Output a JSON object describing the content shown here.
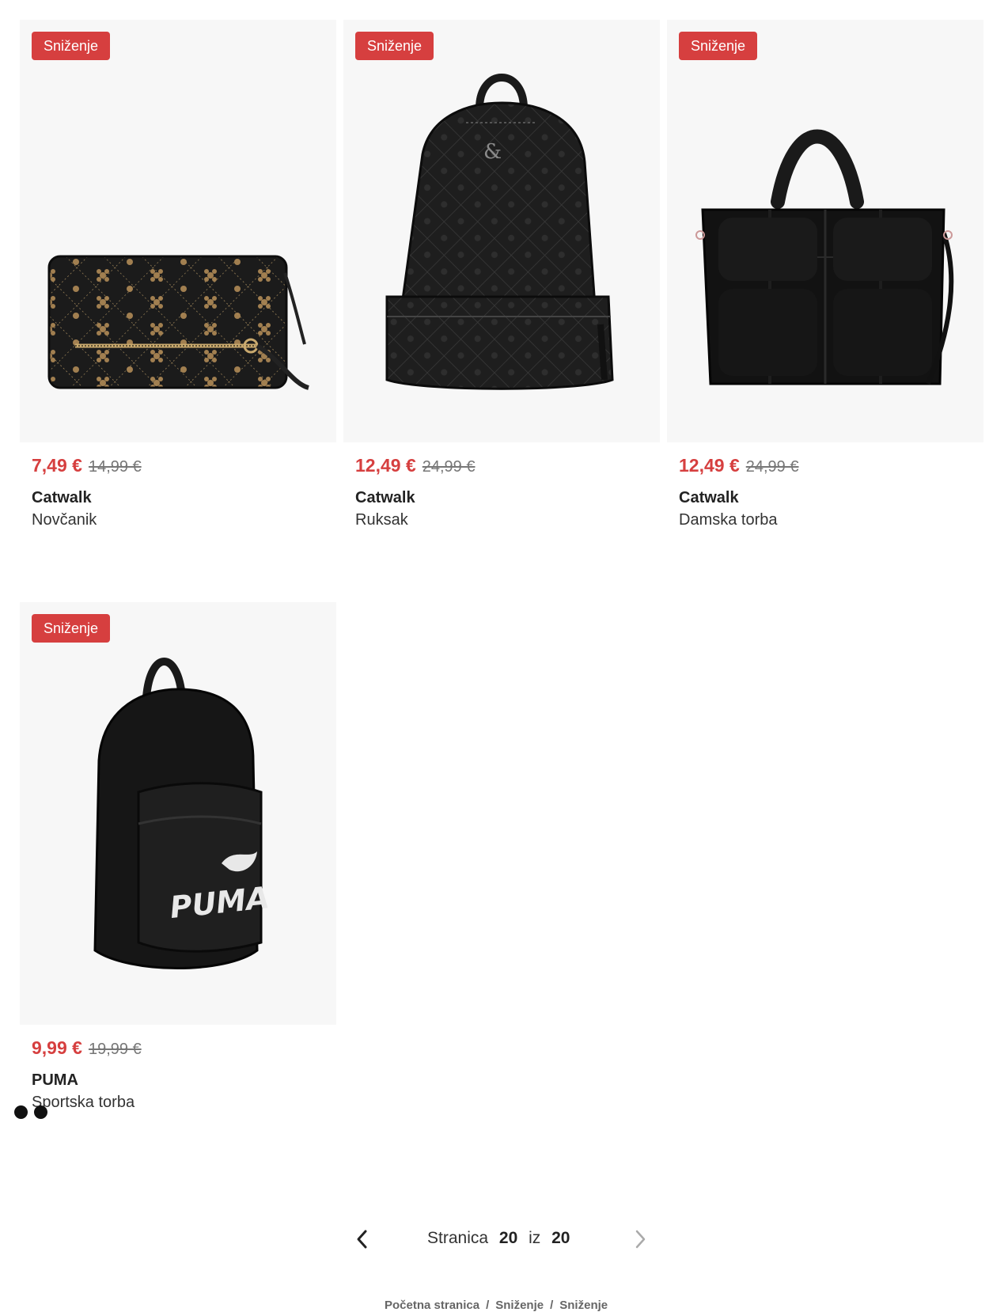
{
  "products": [
    {
      "badge": "Sniženje",
      "price_new": "7,49 €",
      "price_old": "14,99 €",
      "brand": "Catwalk",
      "name": "Novčanik",
      "image": "black-wallet-image"
    },
    {
      "badge": "Sniženje",
      "price_new": "12,49 €",
      "price_old": "24,99 €",
      "brand": "Catwalk",
      "name": "Ruksak",
      "image": "black-backpack-image"
    },
    {
      "badge": "Sniženje",
      "price_new": "12,49 €",
      "price_old": "24,99 €",
      "brand": "Catwalk",
      "name": "Damska torba",
      "image": "black-tote-image"
    },
    {
      "badge": "Sniženje",
      "price_new": "9,99 €",
      "price_old": "19,99 €",
      "brand": "PUMA",
      "name": "Sportska torba",
      "image": "puma-backpack-image",
      "swatch_colors": [
        "#111111",
        "#111111"
      ]
    }
  ],
  "pagination": {
    "label": "Stranica",
    "current": "20",
    "of": "iz",
    "total": "20",
    "prev_icon": "chevron-left-icon",
    "next_icon": "chevron-right-icon"
  },
  "breadcrumb": {
    "items": [
      "Početna stranica",
      "Sniženje",
      "Sniženje"
    ],
    "separator": "/"
  },
  "colors": {
    "sale": "#d63f3f",
    "image_bg": "#f7f7f7"
  }
}
